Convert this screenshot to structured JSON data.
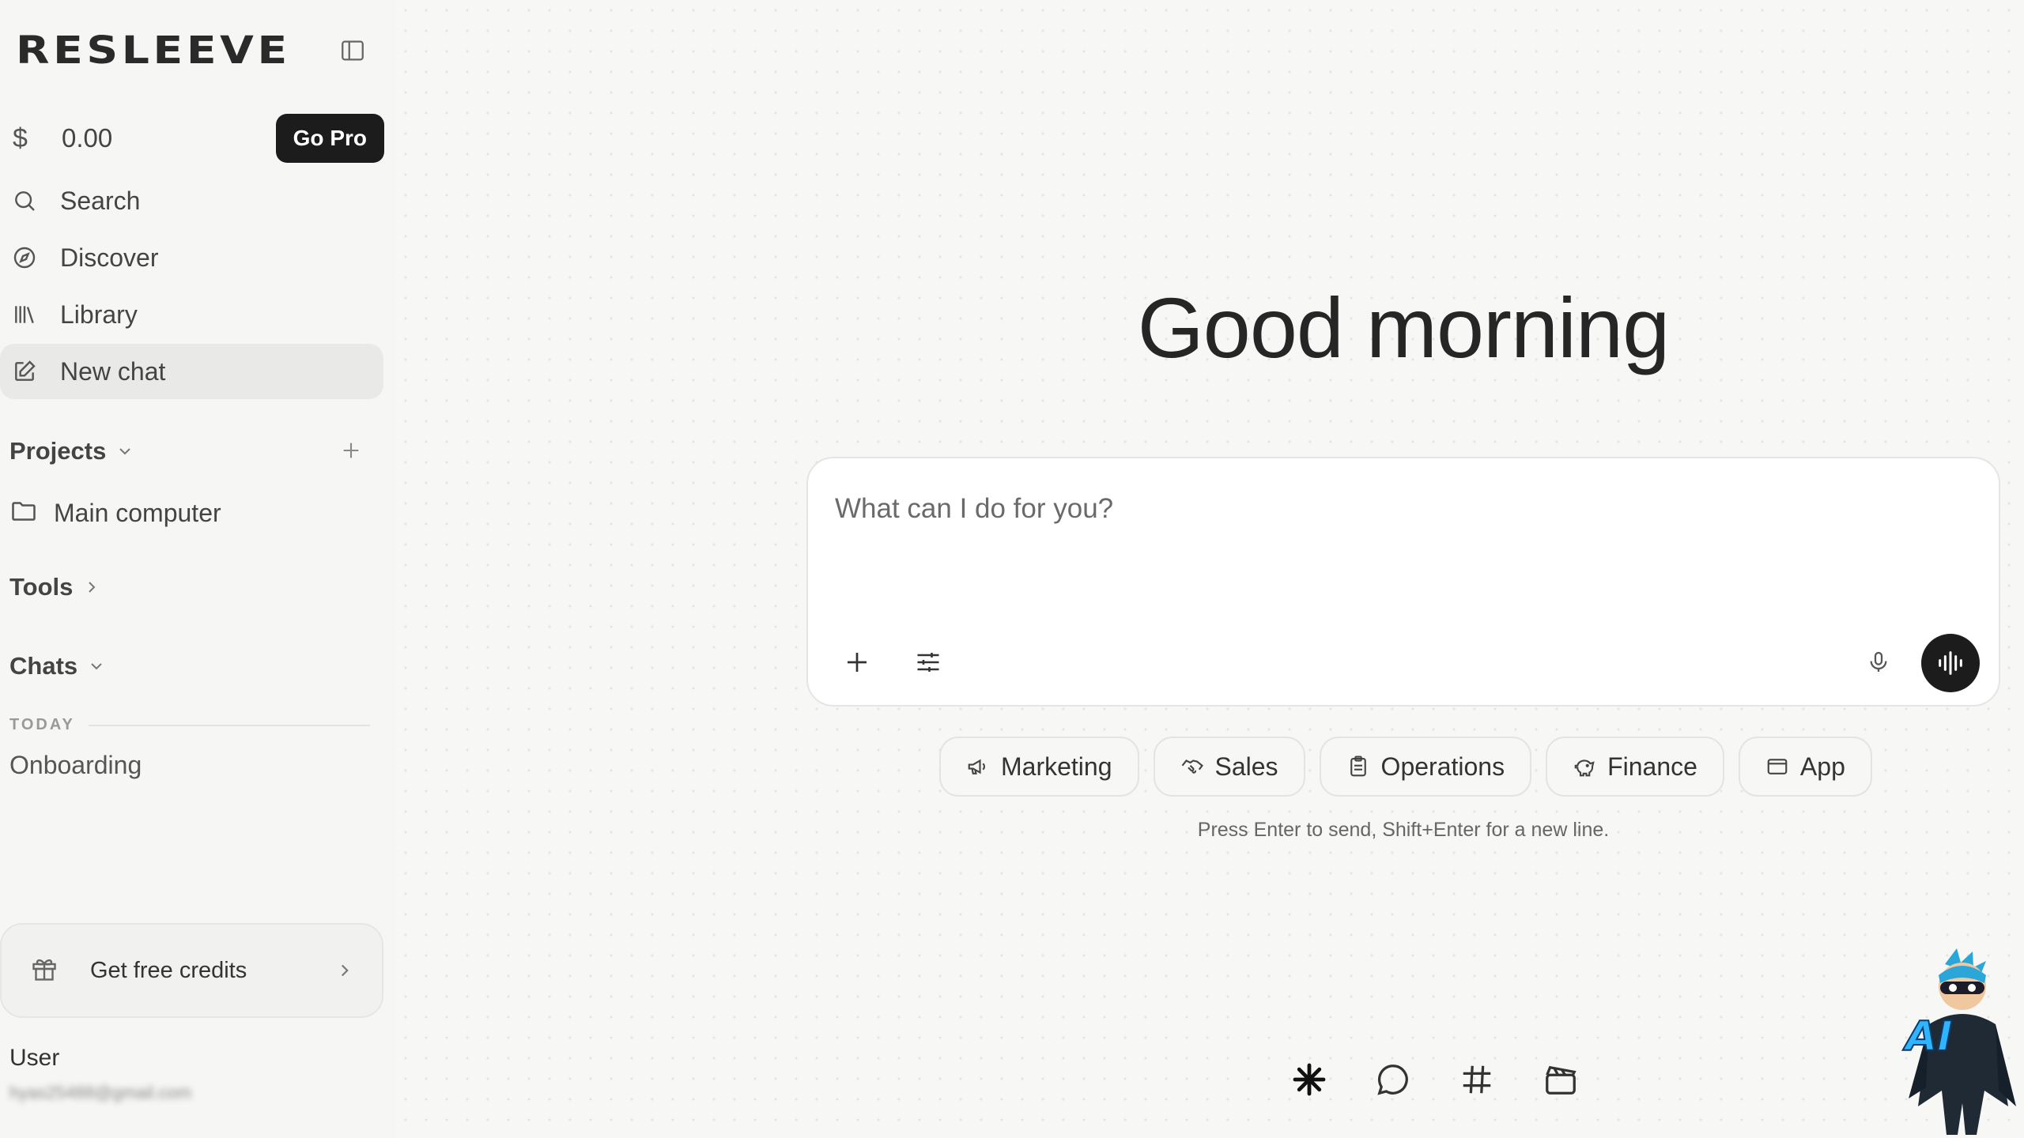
{
  "app": {
    "logo": "RESLEEVE"
  },
  "sidebar": {
    "currency_symbol": "$",
    "credits": "0.00",
    "go_pro_label": "Go Pro",
    "nav": [
      {
        "label": "Search",
        "icon": "search-icon"
      },
      {
        "label": "Discover",
        "icon": "compass-icon"
      },
      {
        "label": "Library",
        "icon": "library-icon"
      },
      {
        "label": "New chat",
        "icon": "edit-icon",
        "active": true
      }
    ],
    "projects": {
      "label": "Projects",
      "items": [
        {
          "label": "Main computer",
          "icon": "folder-icon"
        }
      ]
    },
    "tools": {
      "label": "Tools"
    },
    "chats": {
      "label": "Chats",
      "group_label": "TODAY",
      "items": [
        {
          "label": "Onboarding"
        }
      ]
    },
    "free_credits_label": "Get free credits",
    "user": {
      "name": "User",
      "email": "hyas25488@gmail.com"
    }
  },
  "main": {
    "greeting": "Good morning",
    "composer": {
      "placeholder": "What can I do for you?"
    },
    "chips": [
      {
        "label": "Marketing",
        "icon": "megaphone-icon"
      },
      {
        "label": "Sales",
        "icon": "handshake-icon"
      },
      {
        "label": "Operations",
        "icon": "clipboard-icon"
      },
      {
        "label": "Finance",
        "icon": "piggy-bank-icon"
      },
      {
        "label": "App",
        "icon": "app-window-icon"
      }
    ],
    "hint": "Press Enter to send, Shift+Enter for a new line.",
    "bottom_icons": [
      "asterisk-icon",
      "chat-bubble-icon",
      "hash-icon",
      "clapperboard-icon"
    ],
    "mascot_label": "AI"
  },
  "colors": {
    "accent": "#1c1c1c",
    "background": "#f6f6f5",
    "mascot_blue": "#2fb4ff"
  }
}
